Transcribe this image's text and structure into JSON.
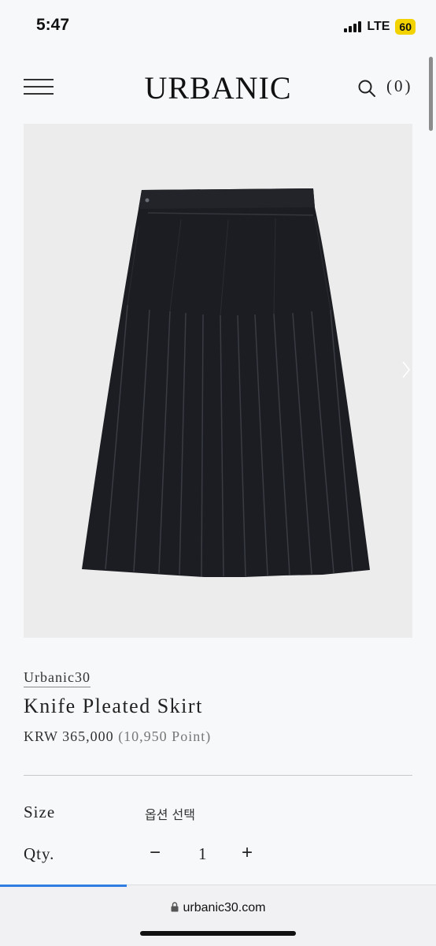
{
  "status_bar": {
    "time": "5:47",
    "network": "LTE",
    "battery": "60",
    "battery_color": "#f2d300"
  },
  "header": {
    "logo": "URBANIC",
    "menu_icon": "hamburger-menu-icon",
    "search_icon": "search-icon",
    "cart_count": "(0)"
  },
  "product": {
    "image_alt": "Knife Pleated Skirt",
    "brand": "Urbanic30",
    "name": "Knife Pleated Skirt",
    "price": "KRW 365,000",
    "points": "(10,950 Point)"
  },
  "options": {
    "size_label": "Size",
    "size_placeholder": "옵션 선택",
    "qty_label": "Qty.",
    "qty_minus": "−",
    "qty_value": "1",
    "qty_plus": "+"
  },
  "browser": {
    "url": "urbanic30.com",
    "load_progress": 0.29,
    "accent": "#2f7de1"
  }
}
